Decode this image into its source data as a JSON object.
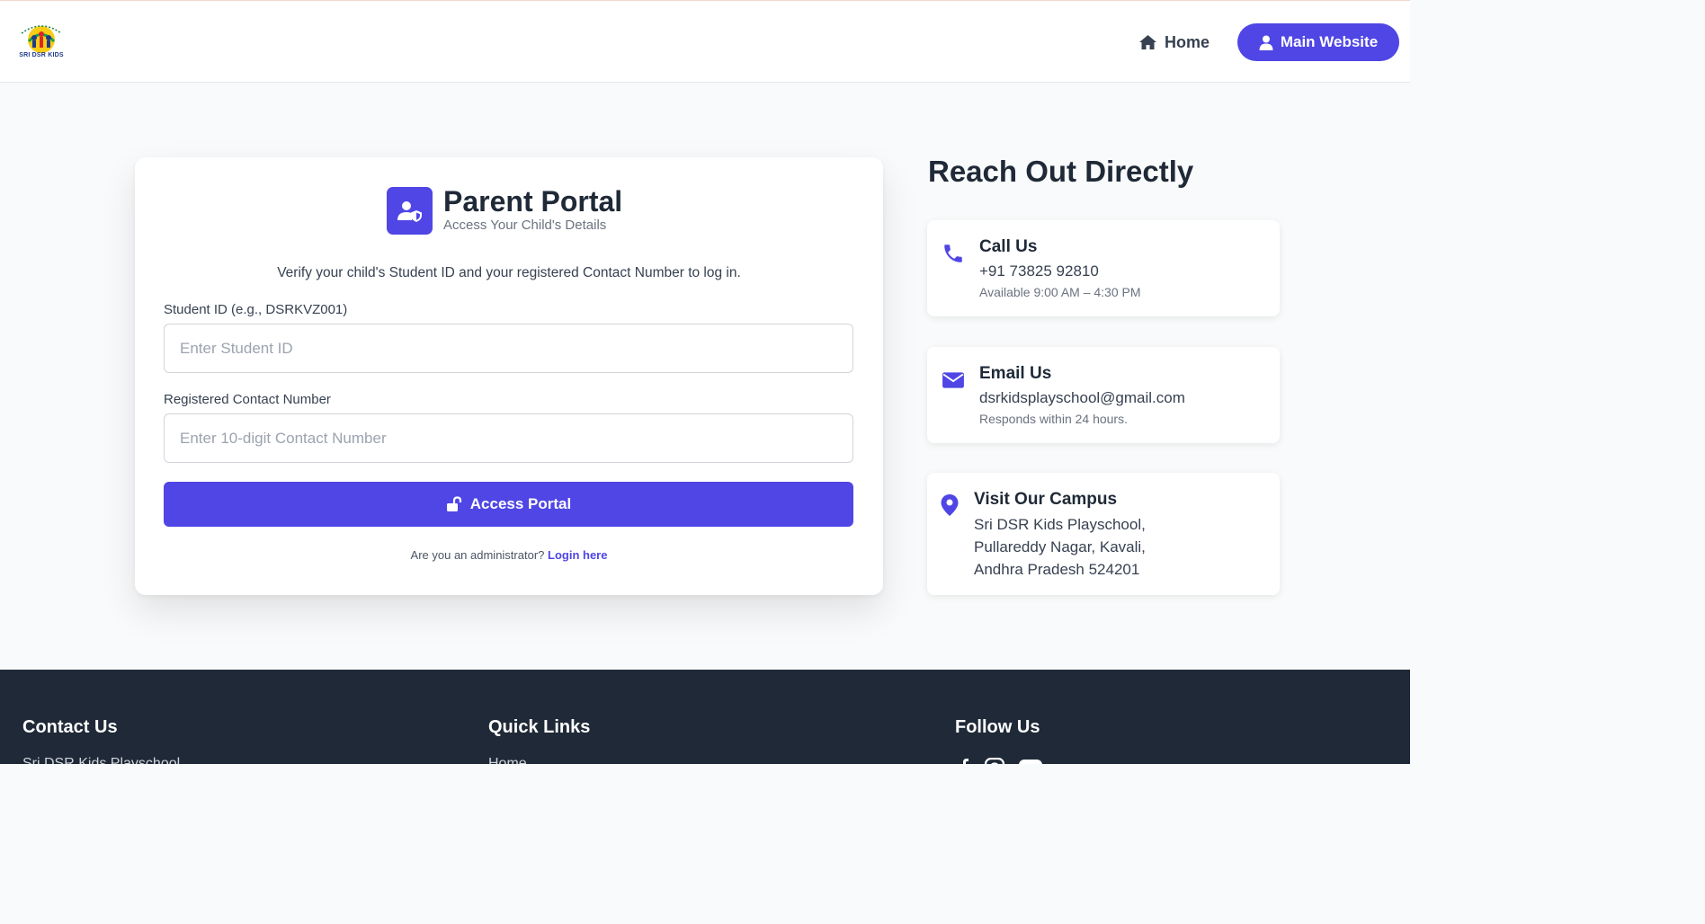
{
  "header": {
    "logo_text": "SRI DSR KIDS",
    "nav_home_label": "Home",
    "nav_main_label": "Main Website"
  },
  "portal": {
    "title": "Parent Portal",
    "subtitle": "Access Your Child's Details",
    "intro": "Verify your child's Student ID and your registered Contact Number to log in.",
    "student_id_label": "Student ID (e.g., DSRKVZ001)",
    "student_id_placeholder": "Enter Student ID",
    "contact_label": "Registered Contact Number",
    "contact_placeholder": "Enter 10-digit Contact Number",
    "access_button": "Access Portal",
    "admin_prompt": "Are you an administrator?",
    "admin_link": "Login here"
  },
  "reach": {
    "title": "Reach Out Directly",
    "call": {
      "title": "Call Us",
      "value": "+91 73825 92810",
      "note": "Available 9:00 AM – 4:30 PM"
    },
    "email": {
      "title": "Email Us",
      "value": "dsrkidsplayschool@gmail.com",
      "note": "Responds within 24 hours."
    },
    "visit": {
      "title": "Visit Our Campus",
      "line1": "Sri DSR Kids Playschool,",
      "line2": "Pullareddy Nagar, Kavali,",
      "line3": "Andhra Pradesh 524201"
    }
  },
  "footer": {
    "contact_heading": "Contact Us",
    "contact_line": "Sri DSR Kids Playschool",
    "links_heading": "Quick Links",
    "links_first": "Home",
    "follow_heading": "Follow Us"
  },
  "colors": {
    "accent": "#4f46e5",
    "footer_bg": "#1f2937",
    "page_bg": "#f9fafb"
  }
}
